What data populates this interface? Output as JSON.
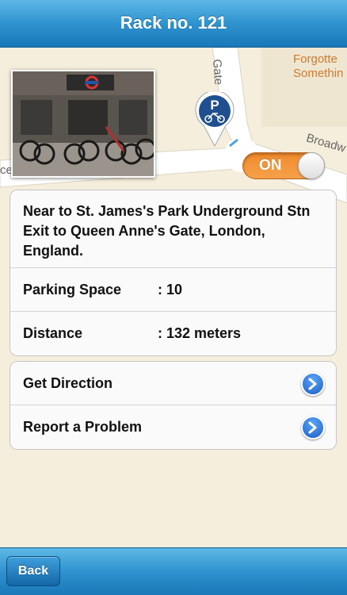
{
  "header": {
    "title": "Rack no. 121"
  },
  "map": {
    "street_labels": {
      "gate": "Gate",
      "broadway": "Broadw",
      "left_fragment": "ce"
    },
    "poi_label": {
      "line1": "Forgotte",
      "line2": "Somethin"
    },
    "pin_icon": "bicycle-parking-pin-icon",
    "pin_letter": "P",
    "toggle": {
      "label": "ON",
      "state": "on",
      "color": "#f08a2c"
    }
  },
  "photo": {
    "subject": "underground-station-bike-rack-photo",
    "station_sign": "ST JAMES'S PARK"
  },
  "details": {
    "address": "Near to St. James's Park Underground Stn Exit to Queen Anne's Gate, London, England.",
    "parking_space": {
      "label": "Parking Space",
      "value": ": 10"
    },
    "distance": {
      "label": "Distance",
      "value": ": 132 meters"
    }
  },
  "actions": [
    {
      "label": "Get Direction",
      "icon": "chevron-right-circle-icon"
    },
    {
      "label": "Report a Problem",
      "icon": "chevron-right-circle-icon"
    }
  ],
  "toolbar": {
    "back_label": "Back"
  },
  "colors": {
    "nav_blue": "#2f93cf",
    "map_bg": "#f6eedc",
    "toggle_orange": "#f08a2c",
    "disclosure_blue": "#1d60c8"
  }
}
